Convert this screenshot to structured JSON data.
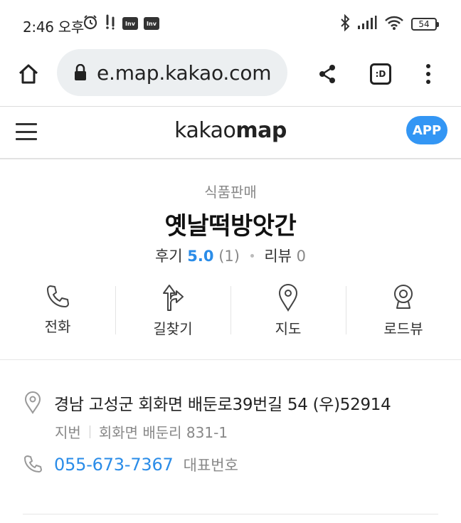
{
  "status_bar": {
    "time": "2:46 오후",
    "battery": "54",
    "left_icons": [
      "alarm-icon",
      "dual-exclamation-icon",
      "inv-badge",
      "inv-badge"
    ],
    "right_icons": [
      "bluetooth-icon",
      "signal-icon",
      "wifi-icon",
      "battery-icon"
    ],
    "badge_text": "Inv"
  },
  "browser": {
    "url": "e.map.kakao.com",
    "tabs_label": ":D"
  },
  "kakao_header": {
    "logo_light": "kakao",
    "logo_bold": "map",
    "app_button": "APP"
  },
  "place": {
    "category": "식품판매",
    "name": "옛날떡방앗간",
    "rating_label": "후기",
    "rating_score": "5.0",
    "rating_count": "(1)",
    "review_label": "리뷰",
    "review_count": "0"
  },
  "actions": [
    {
      "label": "전화",
      "icon": "phone-icon"
    },
    {
      "label": "길찾기",
      "icon": "directions-icon"
    },
    {
      "label": "지도",
      "icon": "map-pin-icon"
    },
    {
      "label": "로드뷰",
      "icon": "roadview-camera-icon"
    }
  ],
  "address": {
    "road": "경남 고성군 회화면 배둔로39번길 54 (우)52914",
    "jibun_label": "지번",
    "jibun": "회화면 배둔리 831-1",
    "phone": "055-673-7367",
    "phone_desc": "대표번호"
  },
  "colors": {
    "accent": "#3396f4",
    "link": "#2a8ce8"
  }
}
